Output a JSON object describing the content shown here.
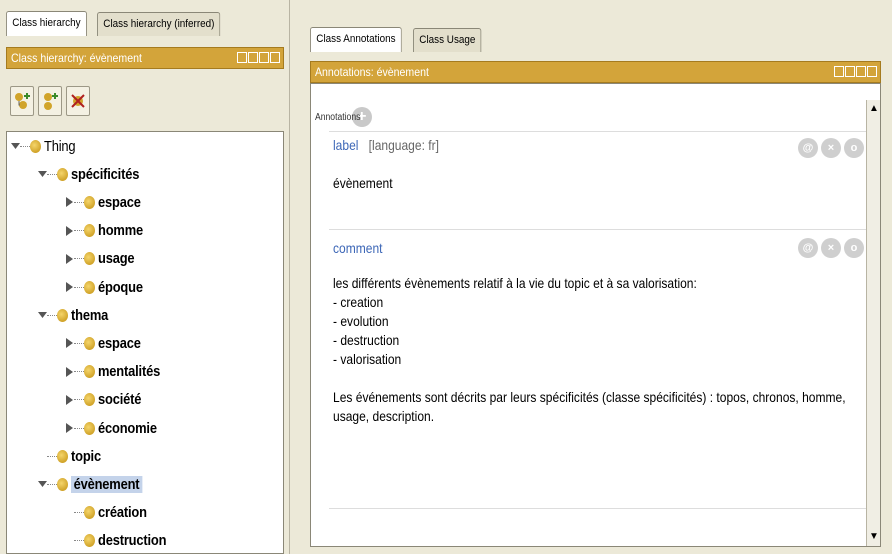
{
  "left": {
    "tabs": [
      {
        "label": "Class hierarchy",
        "active": true
      },
      {
        "label": "Class hierarchy (inferred)",
        "active": false
      }
    ],
    "panel_title": "Class hierarchy: évènement",
    "toolbar": [
      {
        "icon": "add-subclass-icon"
      },
      {
        "icon": "add-sibling-class-icon"
      },
      {
        "icon": "delete-class-icon"
      }
    ],
    "tree": [
      {
        "label": "Thing",
        "depth": 0,
        "toggle": "expanded",
        "bold": false
      },
      {
        "label": "spécificités",
        "depth": 1,
        "toggle": "expanded",
        "bold": true
      },
      {
        "label": "espace",
        "depth": 2,
        "toggle": "collapsed",
        "bold": true
      },
      {
        "label": "homme",
        "depth": 2,
        "toggle": "collapsed",
        "bold": true
      },
      {
        "label": "usage",
        "depth": 2,
        "toggle": "collapsed",
        "bold": true
      },
      {
        "label": "époque",
        "depth": 2,
        "toggle": "collapsed",
        "bold": true
      },
      {
        "label": "thema",
        "depth": 1,
        "toggle": "expanded",
        "bold": true
      },
      {
        "label": "espace",
        "depth": 2,
        "toggle": "collapsed",
        "bold": true
      },
      {
        "label": "mentalités",
        "depth": 2,
        "toggle": "collapsed",
        "bold": true
      },
      {
        "label": "société",
        "depth": 2,
        "toggle": "collapsed",
        "bold": true
      },
      {
        "label": "économie",
        "depth": 2,
        "toggle": "collapsed",
        "bold": true
      },
      {
        "label": "topic",
        "depth": 1,
        "toggle": "none",
        "bold": true
      },
      {
        "label": "évènement",
        "depth": 1,
        "toggle": "expanded",
        "bold": true,
        "selected": true
      },
      {
        "label": "création",
        "depth": 2,
        "toggle": "none",
        "bold": true
      },
      {
        "label": "destruction",
        "depth": 2,
        "toggle": "none",
        "bold": true
      }
    ]
  },
  "right": {
    "tabs": [
      {
        "label": "Class Annotations",
        "active": true
      },
      {
        "label": "Class Usage",
        "active": false
      }
    ],
    "panel_title": "Annotations: évènement",
    "annotations_label": "Annotations",
    "annotations": [
      {
        "property": "label",
        "language": "[language: fr]",
        "value": "évènement"
      },
      {
        "property": "comment",
        "language": "",
        "value": "les différents évènements relatif à la vie du topic et à sa valorisation:\n- creation\n- evolution\n- destruction\n- valorisation\n\nLes événements sont décrits par leurs spécificités (classe spécificités) : topos, chronos, homme,\nusage, description."
      }
    ],
    "action_icons": {
      "annotate": "@",
      "delete": "×",
      "edit": "o"
    }
  },
  "colors": {
    "header": "#d3a43a",
    "selection": "#c4d3ea",
    "property_link": "#3d67b7",
    "class_bullet": "#e6b93b"
  }
}
